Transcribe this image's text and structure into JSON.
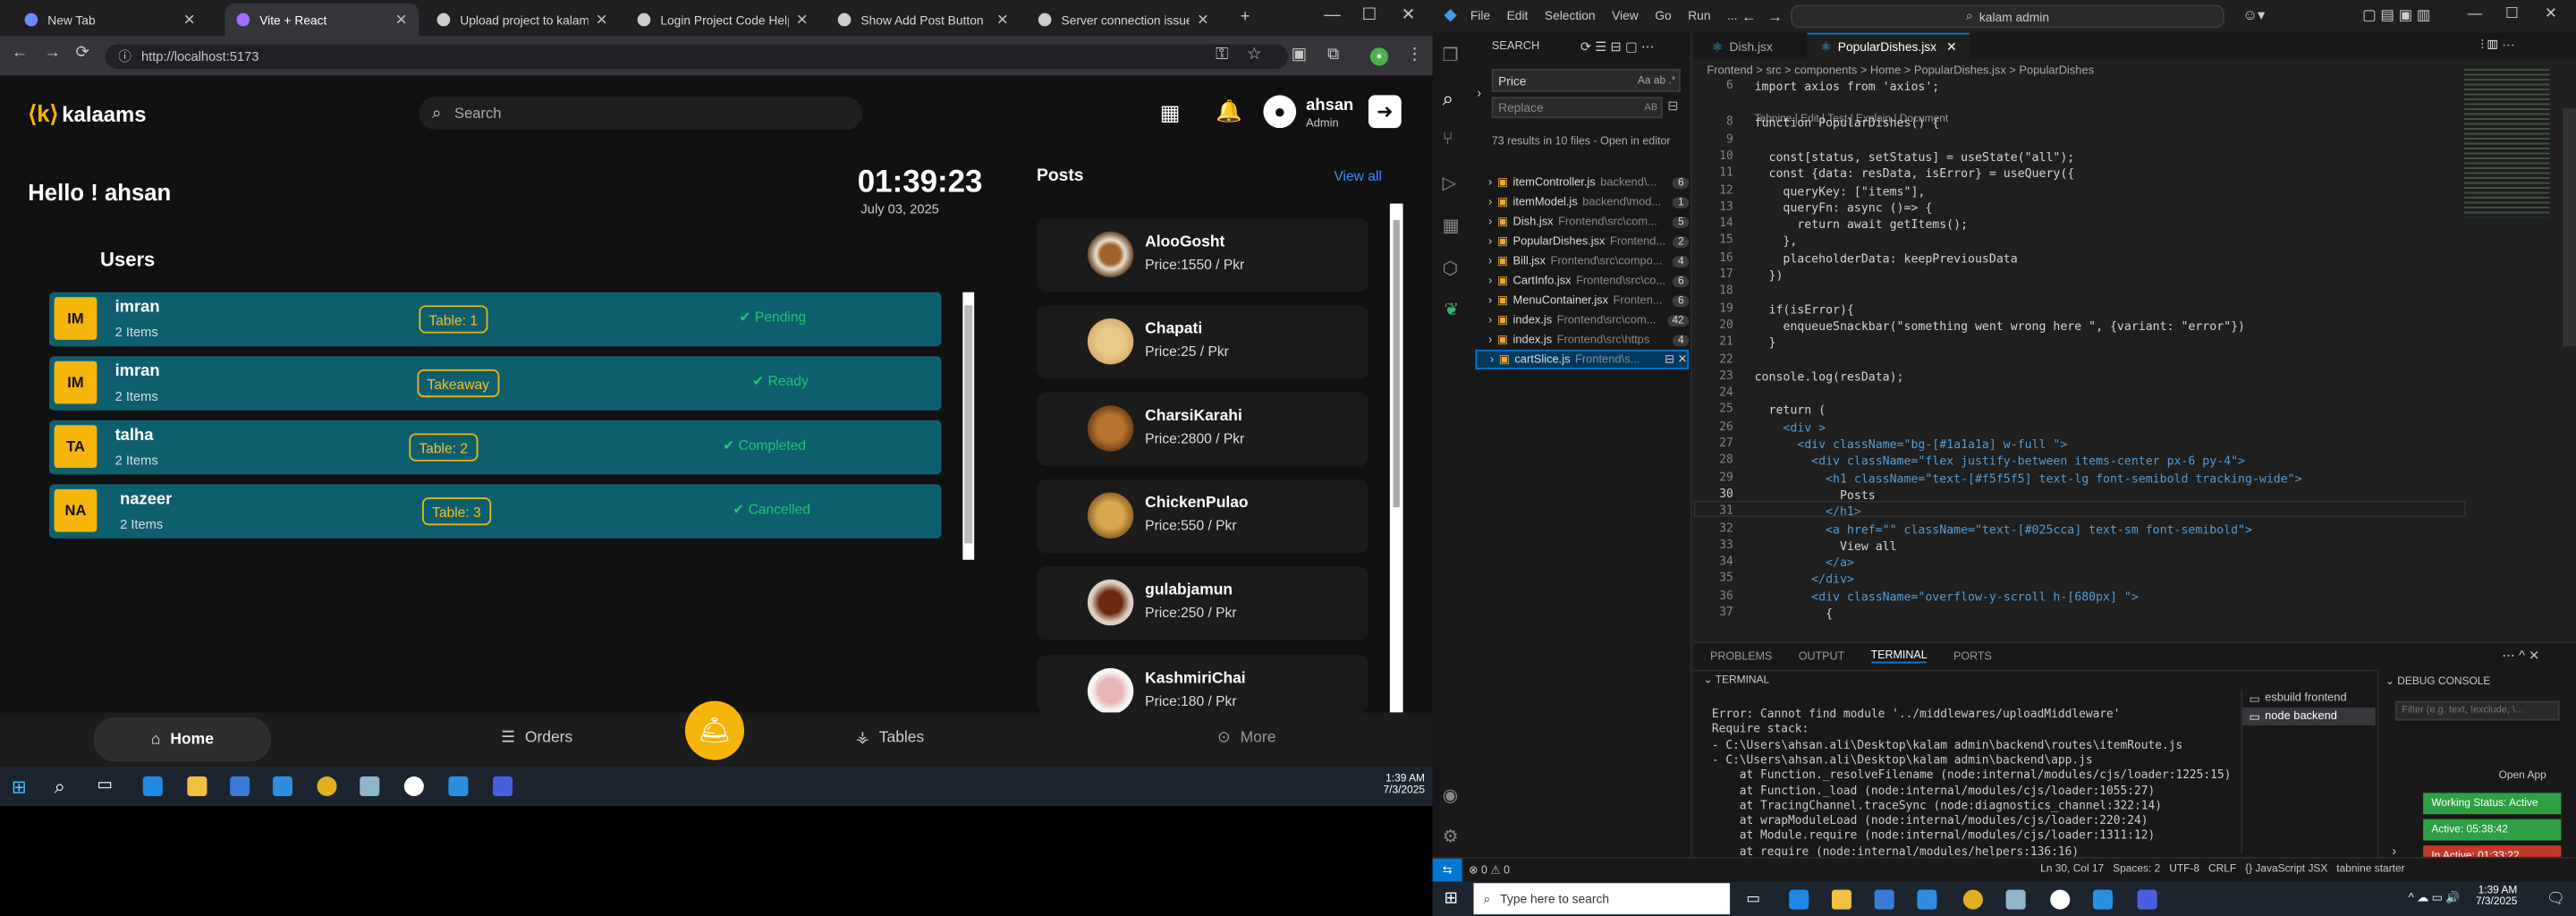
{
  "browser": {
    "tabs": [
      {
        "label": "New Tab",
        "color": "#6b8cff"
      },
      {
        "label": "Vite + React",
        "color": "#a46bff"
      },
      {
        "label": "Upload project to kalams.org",
        "color": "#cccccc"
      },
      {
        "label": "Login Project Code Help",
        "color": "#cccccc"
      },
      {
        "label": "Show Add Post Button",
        "color": "#cccccc"
      },
      {
        "label": "Server connection issue fix",
        "color": "#cccccc"
      }
    ],
    "url": "http://localhost:5173"
  },
  "app": {
    "logo": "kalaams",
    "search_placeholder": "Search",
    "user_name": "ahsan",
    "user_role": "Admin",
    "greeting": "Hello ! ahsan",
    "time": "01:39:23",
    "date": "July 03, 2025",
    "users_title": "Users",
    "users": [
      {
        "initials": "IM",
        "name": "imran",
        "items": "2 Items",
        "table": "Table: 1",
        "status": "Pending",
        "status_color": "#23c46d"
      },
      {
        "initials": "IM",
        "name": "imran",
        "items": "2 Items",
        "table": "Takeaway",
        "status": "Ready",
        "status_color": "#23c46d"
      },
      {
        "initials": "TA",
        "name": "talha",
        "items": "2 Items",
        "table": "Table: 2",
        "status": "Completed",
        "status_color": "#23c46d"
      },
      {
        "initials": "NA",
        "name": "nazeer",
        "items": "2 Items",
        "table": "Table: 3",
        "status": "Cancelled",
        "status_color": "#23c46d"
      }
    ],
    "posts_title": "Posts",
    "view_all": "View all",
    "posts": [
      {
        "name": "AlooGosht",
        "price": "Price:1550 / Pkr"
      },
      {
        "name": "Chapati",
        "price": "Price:25 / Pkr"
      },
      {
        "name": "CharsiKarahi",
        "price": "Price:2800 / Pkr"
      },
      {
        "name": "ChickenPulao",
        "price": "Price:550 / Pkr"
      },
      {
        "name": "gulabjamun",
        "price": "Price:250 / Pkr"
      },
      {
        "name": "KashmiriChai",
        "price": "Price:180 / Pkr"
      }
    ],
    "nav": {
      "home": "Home",
      "orders": "Orders",
      "tables": "Tables",
      "more": "More"
    },
    "accent": "#f5b50a",
    "teal": "#0e5f6e"
  },
  "taskbar_left": {
    "time": "1:39 AM",
    "date": "7/3/2025"
  },
  "vscode": {
    "menu": [
      "File",
      "Edit",
      "Selection",
      "View",
      "Go",
      "Run",
      "..."
    ],
    "command_center": "kalam admin",
    "sidebar_title": "SEARCH",
    "search_value": "Price",
    "replace_placeholder": "Replace",
    "results_summary": "73 results in 10 files - Open in editor",
    "results": [
      {
        "file": "itemController.js",
        "path": "backend\\...",
        "count": "6"
      },
      {
        "file": "itemModel.js",
        "path": "backend\\mod...",
        "count": "1"
      },
      {
        "file": "Dish.jsx",
        "path": "Frontend\\src\\com...",
        "count": "5"
      },
      {
        "file": "PopularDishes.jsx",
        "path": "Frontend...",
        "count": "2"
      },
      {
        "file": "Bill.jsx",
        "path": "Frontend\\src\\compo...",
        "count": "4"
      },
      {
        "file": "CartInfo.jsx",
        "path": "Frontend\\src\\co...",
        "count": "6"
      },
      {
        "file": "MenuContainer.jsx",
        "path": "Fronten...",
        "count": "6"
      },
      {
        "file": "index.js",
        "path": "Frontend\\src\\com...",
        "count": "42"
      },
      {
        "file": "index.js",
        "path": "Frontend\\src\\https",
        "count": "4"
      },
      {
        "file": "cartSlice.js",
        "path": "Frontend\\s...",
        "count": ""
      }
    ],
    "editor_tabs": [
      "Dish.jsx",
      "PopularDishes.jsx"
    ],
    "breadcrumb": "Frontend > src > components > Home > PopularDishes.jsx > PopularDishes",
    "codelens": "Tabnine | Edit | Test | Explain | Document",
    "code_lines": [
      {
        "n": "6",
        "t": "import axios from 'axios';"
      },
      {
        "n": "8",
        "t": "function PopularDishes() {"
      },
      {
        "n": "9",
        "t": ""
      },
      {
        "n": "10",
        "t": "  const[status, setStatus] = useState(\"all\");"
      },
      {
        "n": "11",
        "t": "  const {data: resData, isError} = useQuery({"
      },
      {
        "n": "12",
        "t": "    queryKey: [\"items\"],"
      },
      {
        "n": "13",
        "t": "    queryFn: async ()=> {"
      },
      {
        "n": "14",
        "t": "      return await getItems();"
      },
      {
        "n": "15",
        "t": "    },"
      },
      {
        "n": "16",
        "t": "    placeholderData: keepPreviousData"
      },
      {
        "n": "17",
        "t": "  })"
      },
      {
        "n": "18",
        "t": ""
      },
      {
        "n": "19",
        "t": "  if(isError){"
      },
      {
        "n": "20",
        "t": "    enqueueSnackbar(\"something went wrong here \", {variant: \"error\"})"
      },
      {
        "n": "21",
        "t": "  }"
      },
      {
        "n": "22",
        "t": ""
      },
      {
        "n": "23",
        "t": "console.log(resData);"
      },
      {
        "n": "24",
        "t": ""
      },
      {
        "n": "25",
        "t": "  return ("
      },
      {
        "n": "26",
        "t": "    <div >"
      },
      {
        "n": "27",
        "t": "      <div className=\"bg-[#1a1a1a] w-full \">"
      },
      {
        "n": "28",
        "t": "        <div className=\"flex justify-between items-center px-6 py-4\">"
      },
      {
        "n": "29",
        "t": "          <h1 className=\"text-[#f5f5f5] text-lg font-semibold tracking-wide\">"
      },
      {
        "n": "30",
        "t": "            Posts"
      },
      {
        "n": "31",
        "t": "          </h1>"
      },
      {
        "n": "32",
        "t": "          <a href=\"\" className=\"text-[#025cca] text-sm font-semibold\">"
      },
      {
        "n": "33",
        "t": "            View all"
      },
      {
        "n": "34",
        "t": "          </a>"
      },
      {
        "n": "35",
        "t": "        </div>"
      },
      {
        "n": "36",
        "t": "        <div className=\"overflow-y-scroll h-[680px] \">"
      },
      {
        "n": "37",
        "t": "          {"
      }
    ],
    "panel_tabs": [
      "PROBLEMS",
      "OUTPUT",
      "TERMINAL",
      "PORTS"
    ],
    "terminal_title": "TERMINAL",
    "terminal_lines": [
      "Error: Cannot find module '../middlewares/uploadMiddleware'",
      "Require stack:",
      "- C:\\Users\\ahsan.ali\\Desktop\\kalam admin\\backend\\routes\\itemRoute.js",
      "- C:\\Users\\ahsan.ali\\Desktop\\kalam admin\\backend\\app.js",
      "    at Function._resolveFilename (node:internal/modules/cjs/loader:1225:15)",
      "    at Function._load (node:internal/modules/cjs/loader:1055:27)",
      "    at TracingChannel.traceSync (node:diagnostics_channel:322:14)",
      "    at wrapModuleLoad (node:internal/modules/cjs/loader:220:24)",
      "    at Module.require (node:internal/modules/cjs/loader:1311:12)",
      "    at require (node:internal/modules/helpers:136:16)"
    ],
    "terminals": [
      "esbuild frontend",
      "node backend"
    ],
    "debug_console": "DEBUG CONSOLE",
    "filter_placeholder": "Filter (e.g. text, !exclude, \\...",
    "open_app": "Open App",
    "working_status": "Working Status: Active",
    "active_time": "Active: 05:38:42",
    "inactive_time": "In Active: 01:33:22",
    "status_left": "⊗ 0 ⚠ 0",
    "status_right": "Ln 30, Col 17   Spaces: 2   UTF-8   CRLF   {} JavaScript JSX   tabnine starter"
  },
  "taskbar_right": {
    "search_placeholder": "Type here to search",
    "time": "1:39 AM",
    "date": "7/3/2025"
  }
}
